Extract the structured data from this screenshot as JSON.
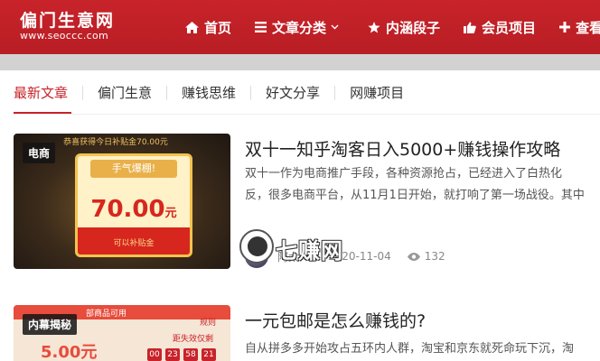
{
  "site": {
    "logo_text": "偏门生意网",
    "logo_url": "www.seoccc.com"
  },
  "nav": {
    "items": [
      {
        "label": "首页",
        "icon": "home-icon"
      },
      {
        "label": "文章分类",
        "icon": "list-icon",
        "has_dropdown": true
      },
      {
        "label": "内涵段子",
        "icon": "star-icon"
      },
      {
        "label": "会员项目",
        "icon": "thumbs-up-icon"
      },
      {
        "label": "查看更多",
        "icon": "plus-icon"
      }
    ]
  },
  "tabs": {
    "items": [
      {
        "label": "最新文章",
        "active": true
      },
      {
        "label": "偏门生意"
      },
      {
        "label": "赚钱思维"
      },
      {
        "label": "好文分享"
      },
      {
        "label": "网赚项目"
      }
    ]
  },
  "colors": {
    "brand_red": "#c8232a",
    "active_tab": "#c8232a",
    "badge_bg": "#222222"
  },
  "articles": [
    {
      "badge": "电商",
      "title": "双十一知乎淘客日入5000+赚钱操作攻略",
      "excerpt": "双十一作为电商推广手段，各种资源抢占，已经进入了白热化",
      "excerpt_line2": "反，很多电商平台，从11月1日开始，就打响了第一场战役。其中",
      "author": "阿太",
      "date": "2020-11-04",
      "views": "132",
      "thumb": {
        "top_text": "恭喜获得今日补贴金70.00元",
        "ribbon": "手气爆棚!",
        "amount": "70.00",
        "unit": "元",
        "bottom_text": "可以补贴金"
      }
    },
    {
      "badge": "内幕揭秘",
      "title": "一元包邮是怎么赚钱的?",
      "excerpt": "自从拼多多开始攻占五环内人群，淘宝和京东就死命玩下沉，淘",
      "thumb": {
        "header_text": "部商品可用",
        "rule": "规则",
        "price": "5.00元",
        "timer_label": "距失效仅剩",
        "timer": [
          "00",
          "23",
          "58",
          "21"
        ]
      }
    }
  ],
  "watermark": {
    "text": "七赚网",
    "icon": "hat-logo-icon"
  }
}
